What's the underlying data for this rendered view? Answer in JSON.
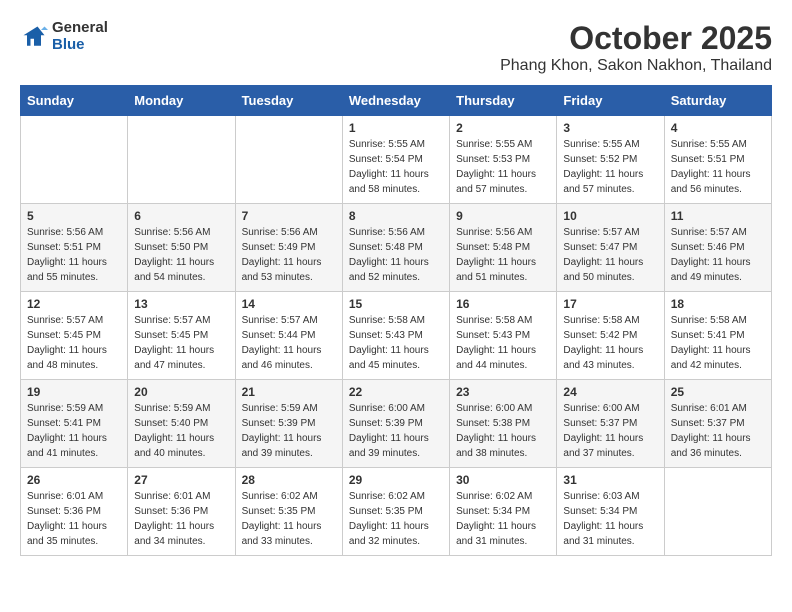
{
  "header": {
    "logo_general": "General",
    "logo_blue": "Blue",
    "month_title": "October 2025",
    "location": "Phang Khon, Sakon Nakhon, Thailand"
  },
  "weekdays": [
    "Sunday",
    "Monday",
    "Tuesday",
    "Wednesday",
    "Thursday",
    "Friday",
    "Saturday"
  ],
  "weeks": [
    [
      {
        "day": "",
        "sunrise": "",
        "sunset": "",
        "daylight": ""
      },
      {
        "day": "",
        "sunrise": "",
        "sunset": "",
        "daylight": ""
      },
      {
        "day": "",
        "sunrise": "",
        "sunset": "",
        "daylight": ""
      },
      {
        "day": "1",
        "sunrise": "5:55 AM",
        "sunset": "5:54 PM",
        "daylight": "11 hours and 58 minutes."
      },
      {
        "day": "2",
        "sunrise": "5:55 AM",
        "sunset": "5:53 PM",
        "daylight": "11 hours and 57 minutes."
      },
      {
        "day": "3",
        "sunrise": "5:55 AM",
        "sunset": "5:52 PM",
        "daylight": "11 hours and 57 minutes."
      },
      {
        "day": "4",
        "sunrise": "5:55 AM",
        "sunset": "5:51 PM",
        "daylight": "11 hours and 56 minutes."
      }
    ],
    [
      {
        "day": "5",
        "sunrise": "5:56 AM",
        "sunset": "5:51 PM",
        "daylight": "11 hours and 55 minutes."
      },
      {
        "day": "6",
        "sunrise": "5:56 AM",
        "sunset": "5:50 PM",
        "daylight": "11 hours and 54 minutes."
      },
      {
        "day": "7",
        "sunrise": "5:56 AM",
        "sunset": "5:49 PM",
        "daylight": "11 hours and 53 minutes."
      },
      {
        "day": "8",
        "sunrise": "5:56 AM",
        "sunset": "5:48 PM",
        "daylight": "11 hours and 52 minutes."
      },
      {
        "day": "9",
        "sunrise": "5:56 AM",
        "sunset": "5:48 PM",
        "daylight": "11 hours and 51 minutes."
      },
      {
        "day": "10",
        "sunrise": "5:57 AM",
        "sunset": "5:47 PM",
        "daylight": "11 hours and 50 minutes."
      },
      {
        "day": "11",
        "sunrise": "5:57 AM",
        "sunset": "5:46 PM",
        "daylight": "11 hours and 49 minutes."
      }
    ],
    [
      {
        "day": "12",
        "sunrise": "5:57 AM",
        "sunset": "5:45 PM",
        "daylight": "11 hours and 48 minutes."
      },
      {
        "day": "13",
        "sunrise": "5:57 AM",
        "sunset": "5:45 PM",
        "daylight": "11 hours and 47 minutes."
      },
      {
        "day": "14",
        "sunrise": "5:57 AM",
        "sunset": "5:44 PM",
        "daylight": "11 hours and 46 minutes."
      },
      {
        "day": "15",
        "sunrise": "5:58 AM",
        "sunset": "5:43 PM",
        "daylight": "11 hours and 45 minutes."
      },
      {
        "day": "16",
        "sunrise": "5:58 AM",
        "sunset": "5:43 PM",
        "daylight": "11 hours and 44 minutes."
      },
      {
        "day": "17",
        "sunrise": "5:58 AM",
        "sunset": "5:42 PM",
        "daylight": "11 hours and 43 minutes."
      },
      {
        "day": "18",
        "sunrise": "5:58 AM",
        "sunset": "5:41 PM",
        "daylight": "11 hours and 42 minutes."
      }
    ],
    [
      {
        "day": "19",
        "sunrise": "5:59 AM",
        "sunset": "5:41 PM",
        "daylight": "11 hours and 41 minutes."
      },
      {
        "day": "20",
        "sunrise": "5:59 AM",
        "sunset": "5:40 PM",
        "daylight": "11 hours and 40 minutes."
      },
      {
        "day": "21",
        "sunrise": "5:59 AM",
        "sunset": "5:39 PM",
        "daylight": "11 hours and 39 minutes."
      },
      {
        "day": "22",
        "sunrise": "6:00 AM",
        "sunset": "5:39 PM",
        "daylight": "11 hours and 39 minutes."
      },
      {
        "day": "23",
        "sunrise": "6:00 AM",
        "sunset": "5:38 PM",
        "daylight": "11 hours and 38 minutes."
      },
      {
        "day": "24",
        "sunrise": "6:00 AM",
        "sunset": "5:37 PM",
        "daylight": "11 hours and 37 minutes."
      },
      {
        "day": "25",
        "sunrise": "6:01 AM",
        "sunset": "5:37 PM",
        "daylight": "11 hours and 36 minutes."
      }
    ],
    [
      {
        "day": "26",
        "sunrise": "6:01 AM",
        "sunset": "5:36 PM",
        "daylight": "11 hours and 35 minutes."
      },
      {
        "day": "27",
        "sunrise": "6:01 AM",
        "sunset": "5:36 PM",
        "daylight": "11 hours and 34 minutes."
      },
      {
        "day": "28",
        "sunrise": "6:02 AM",
        "sunset": "5:35 PM",
        "daylight": "11 hours and 33 minutes."
      },
      {
        "day": "29",
        "sunrise": "6:02 AM",
        "sunset": "5:35 PM",
        "daylight": "11 hours and 32 minutes."
      },
      {
        "day": "30",
        "sunrise": "6:02 AM",
        "sunset": "5:34 PM",
        "daylight": "11 hours and 31 minutes."
      },
      {
        "day": "31",
        "sunrise": "6:03 AM",
        "sunset": "5:34 PM",
        "daylight": "11 hours and 31 minutes."
      },
      {
        "day": "",
        "sunrise": "",
        "sunset": "",
        "daylight": ""
      }
    ]
  ]
}
